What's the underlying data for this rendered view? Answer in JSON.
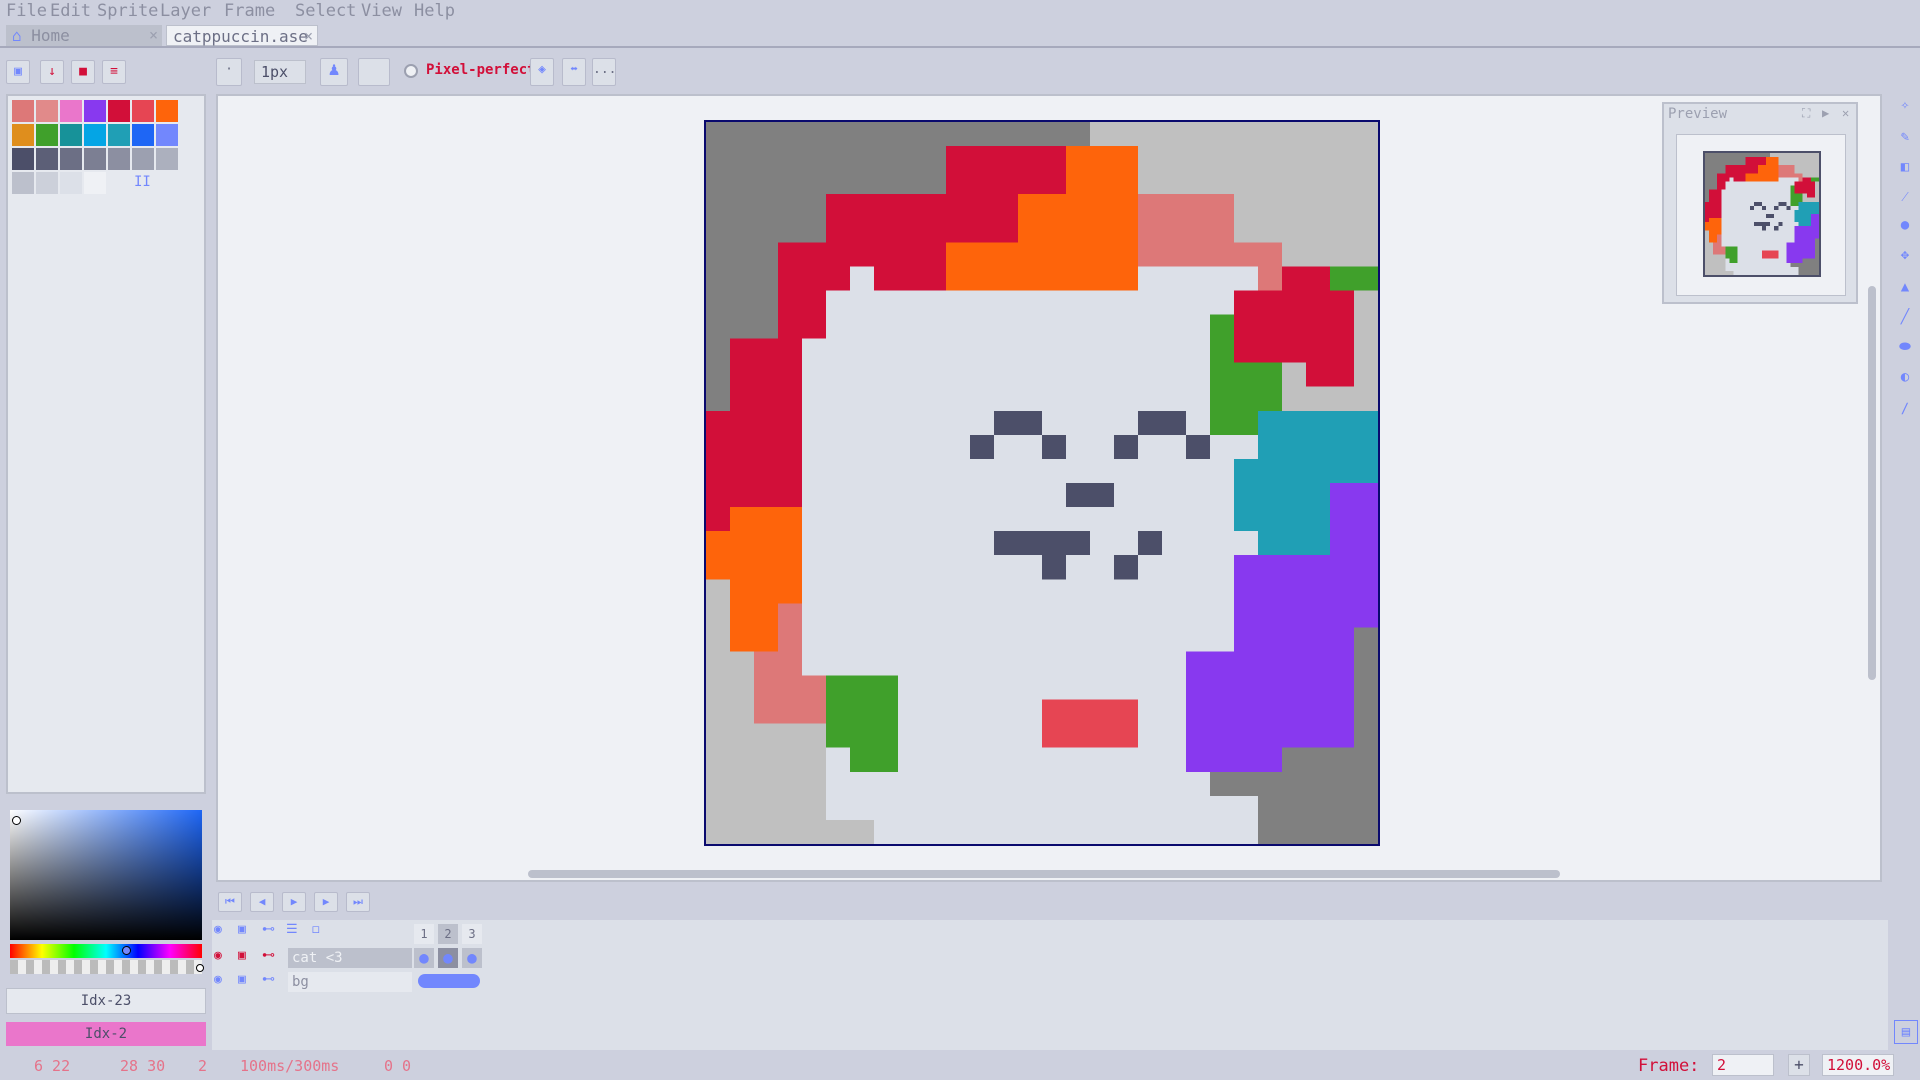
{
  "menu": [
    "File",
    "Edit",
    "Sprite",
    "Layer",
    "Frame",
    "Select",
    "View",
    "Help"
  ],
  "tabs": [
    {
      "label": "Home",
      "close": "×"
    },
    {
      "label": "catppuccin.ase",
      "close": "×"
    }
  ],
  "toolbar": {
    "brush_size": "1px",
    "pixel_perfect_label": "Pixel-perfect",
    "more": "..."
  },
  "palette": {
    "row1": [
      "#dd7878",
      "#e18a8a",
      "#ea76cb",
      "#8839ef",
      "#d20f39",
      "#e64553",
      "#fe640b"
    ],
    "row2": [
      "#df8e1d",
      "#40a02b",
      "#179299",
      "#04a5e5",
      "#209fb5",
      "#1e66f5",
      "#7287fd"
    ],
    "row3": [
      "#4c4f69",
      "#5c5f77",
      "#6c6f85",
      "#7c7f93",
      "#8c8fa1",
      "#9ca0b0",
      "#acb0be"
    ],
    "row4": [
      "#bcc0cc",
      "#ccd0da",
      "#dce0e8",
      "#eff1f5"
    ],
    "page_marker": "II"
  },
  "colors": {
    "fg_index": "Idx-23",
    "bg_index": "Idx-2",
    "bg_index_color": "#ea76cb"
  },
  "preview": {
    "title": "Preview"
  },
  "timeline": {
    "frames": [
      "1",
      "2",
      "3"
    ],
    "layers": [
      {
        "name": "cat <3"
      },
      {
        "name": "bg"
      }
    ]
  },
  "status": {
    "cursor": "6 22",
    "size": "28 30",
    "frame_num": "2",
    "duration": "100ms/300ms",
    "offset": "0 0",
    "frame_label": "Frame:",
    "frame_value": "2",
    "plus": "+",
    "zoom": "1200.0%"
  }
}
